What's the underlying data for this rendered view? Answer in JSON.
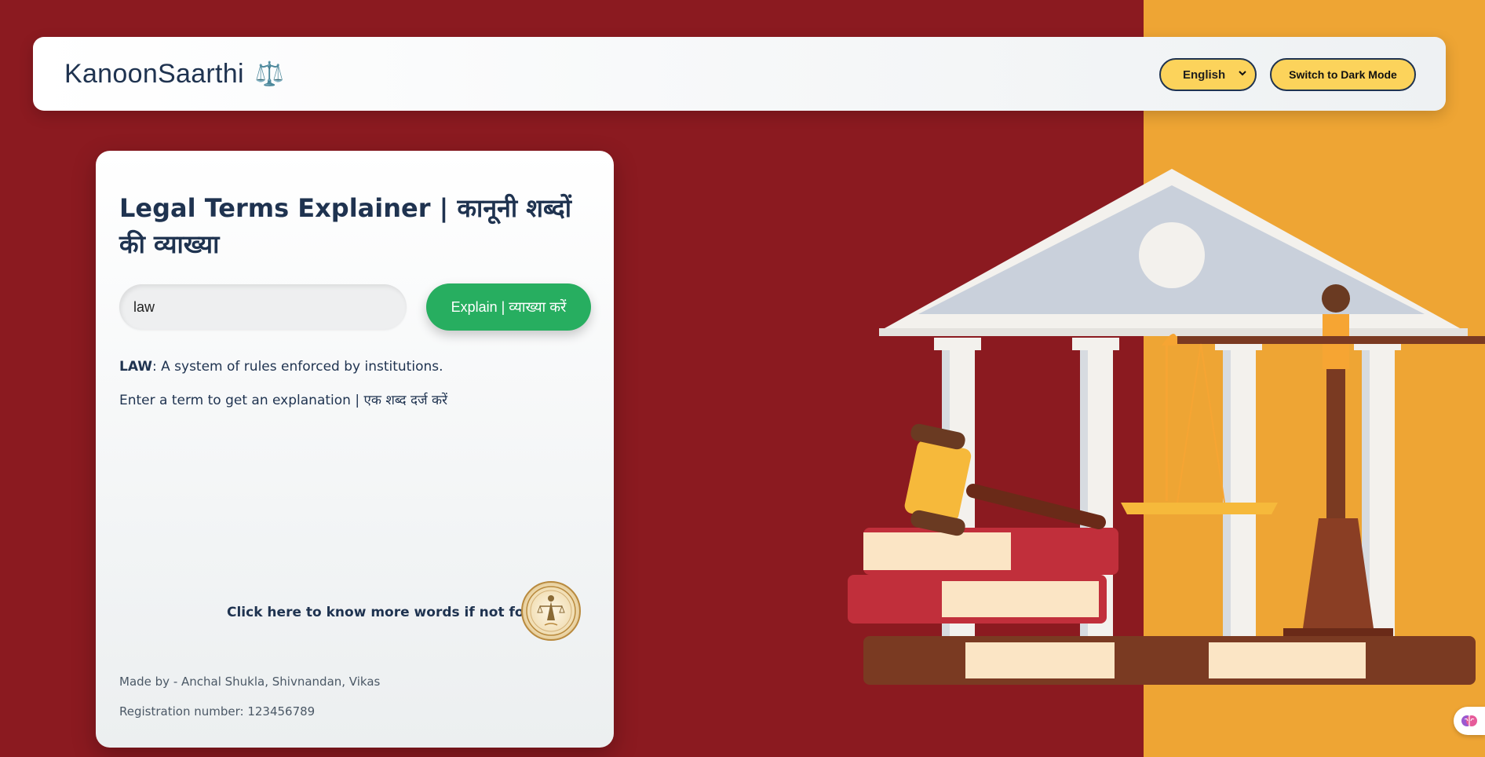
{
  "header": {
    "brand": "KanoonSaarthi",
    "brand_icon": "⚖️",
    "language": {
      "selected": "English",
      "options": [
        "English"
      ]
    },
    "theme_button": "Switch to Dark Mode"
  },
  "explainer": {
    "title": "Legal Terms Explainer | कानूनी शब्दों की व्याख्या",
    "input_value": "law",
    "explain_button": "Explain | व्याख्या करें",
    "result_term": "LAW",
    "result_definition": ": A system of rules enforced by institutions.",
    "hint": "Enter a term to get an explanation | एक शब्द दर्ज करें",
    "more_link": "Click here to know more words if not found:",
    "credit": "Made by - Anchal Shukla, Shivnandan, Vikas",
    "registration": "Registration number: 123456789"
  },
  "colors": {
    "left_bg": "#8b1a20",
    "right_bg": "#eea534",
    "accent_yellow": "#fcd35b",
    "navy": "#1f3350",
    "green": "#27ae60"
  },
  "icons": {
    "brand": "scales-icon",
    "seal": "lady-justice-seal-icon",
    "badge": "brain-icon"
  }
}
